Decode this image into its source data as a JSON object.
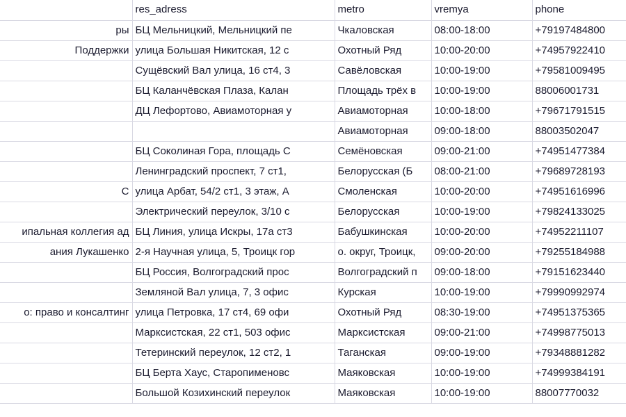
{
  "table": {
    "columns": [
      {
        "key": "name",
        "label": ""
      },
      {
        "key": "address",
        "label": "res_adress"
      },
      {
        "key": "metro",
        "label": "metro"
      },
      {
        "key": "vremya",
        "label": "vremya"
      },
      {
        "key": "phone",
        "label": "phone"
      }
    ],
    "rows": [
      {
        "name": "ры",
        "address": "БЦ Мельницкий, Мельницкий пе",
        "metro": "Чкаловская",
        "vremya": "08:00-18:00",
        "phone": "+79197484800"
      },
      {
        "name": " Поддержки",
        "address": "улица Большая Никитская, 12 с",
        "metro": "Охотный Ряд",
        "vremya": "10:00-20:00",
        "phone": "+74957922410"
      },
      {
        "name": "",
        "address": "Сущёвский Вал улица, 16 ст4, 3",
        "metro": "Савёловская",
        "vremya": "10:00-19:00",
        "phone": "+79581009495"
      },
      {
        "name": "",
        "address": "БЦ Каланчёвская Плаза, Калан",
        "metro": "Площадь трёх в",
        "vremya": "10:00-19:00",
        "phone": "88006001731"
      },
      {
        "name": "",
        "address": "ДЦ Лефортово, Авиамоторная у",
        "metro": "Авиамоторная",
        "vremya": "10:00-18:00",
        "phone": "+79671791515"
      },
      {
        "name": "",
        "address": "",
        "metro": "Авиамоторная",
        "vremya": "09:00-18:00",
        "phone": "88003502047"
      },
      {
        "name": "",
        "address": "БЦ Соколиная Гора, площадь С",
        "metro": "Семёновская",
        "vremya": "09:00-21:00",
        "phone": "+74951477384"
      },
      {
        "name": "",
        "address": "Ленинградский проспект, 7 ст1,",
        "metro": "Белорусская (Б",
        "vremya": "08:00-21:00",
        "phone": "+79689728193"
      },
      {
        "name": "С",
        "address": "улица Арбат, 54/2 ст1, 3 этаж, А",
        "metro": "Смоленская",
        "vremya": "10:00-20:00",
        "phone": "+74951616996"
      },
      {
        "name": "",
        "address": "Электрический переулок, 3/10 с",
        "metro": "Белорусская",
        "vremya": "10:00-19:00",
        "phone": "+79824133025"
      },
      {
        "name": "ипальная коллегия ад",
        "address": "БЦ Линия, улица Искры, 17а ст3",
        "metro": "Бабушкинская",
        "vremya": "10:00-20:00",
        "phone": "+74952211107"
      },
      {
        "name": "ания Лукашенко",
        "address": "2-я Научная улица, 5, Троицк гор",
        "metro": "о. округ, Троицк,",
        "vremya": "09:00-20:00",
        "phone": "+79255184988"
      },
      {
        "name": "",
        "address": "БЦ Россия, Волгоградский прос",
        "metro": "Волгоградский п",
        "vremya": "09:00-18:00",
        "phone": "+79151623440"
      },
      {
        "name": "",
        "address": "Земляной Вал улица, 7, 3 офис",
        "metro": "Курская",
        "vremya": "10:00-19:00",
        "phone": "+79990992974"
      },
      {
        "name": "о: право и консалтинг",
        "address": "улица Петровка, 17 ст4, 69 офи",
        "metro": "Охотный Ряд",
        "vremya": "08:30-19:00",
        "phone": "+74951375365"
      },
      {
        "name": "",
        "address": "Марксистская, 22 ст1, 503 офис",
        "metro": "Марксистская",
        "vremya": "09:00-21:00",
        "phone": "+74998775013"
      },
      {
        "name": "",
        "address": "Тетеринский переулок, 12 ст2, 1",
        "metro": "Таганская",
        "vremya": "09:00-19:00",
        "phone": "+79348881282"
      },
      {
        "name": "",
        "address": "БЦ Берта Хаус, Старопименовс",
        "metro": "Маяковская",
        "vremya": "10:00-19:00",
        "phone": "+74999384191"
      },
      {
        "name": "",
        "address": "Большой Козихинский переулок",
        "metro": "Маяковская",
        "vremya": "10:00-19:00",
        "phone": "88007770032"
      }
    ]
  },
  "colors": {
    "grid_line": "#d9d9e3",
    "text": "#1a1a2e",
    "background": "#ffffff"
  }
}
